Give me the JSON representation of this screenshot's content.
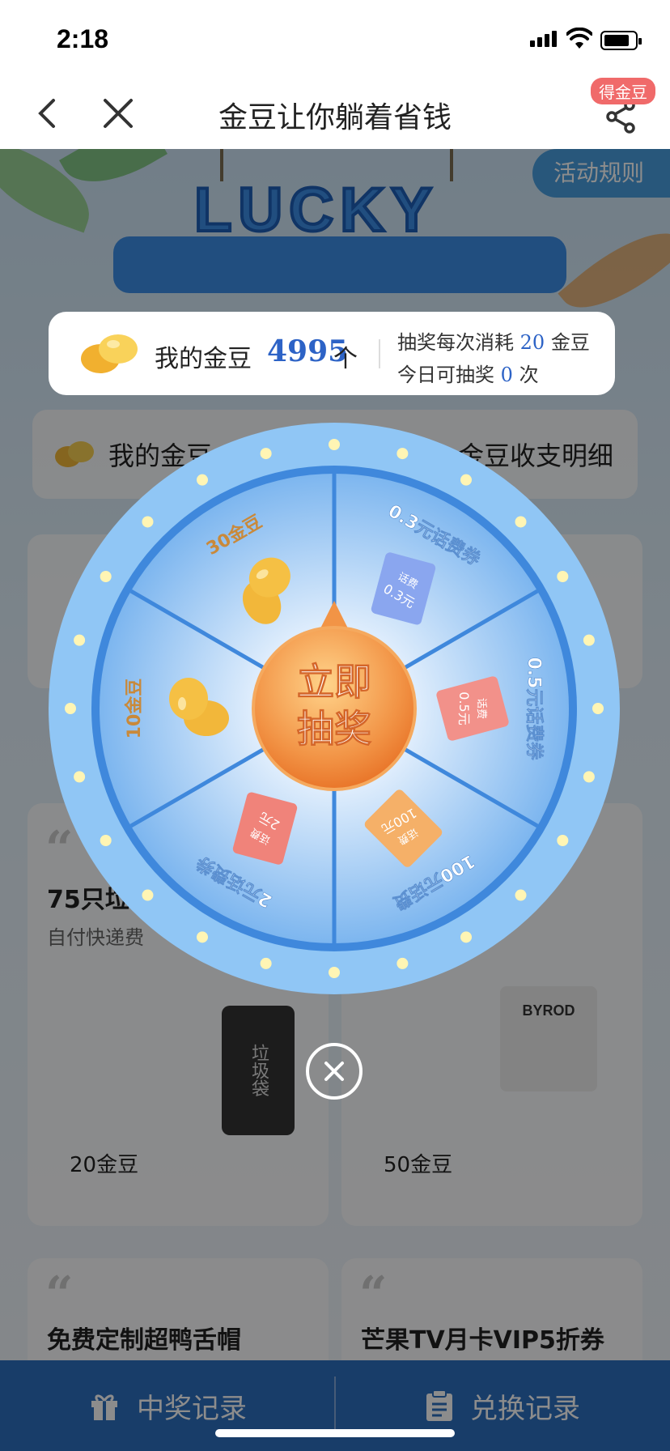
{
  "status_bar": {
    "time": "2:18"
  },
  "nav": {
    "title": "金豆让你躺着省钱",
    "badge": "得金豆"
  },
  "header": {
    "rules": "活动规则",
    "lucky": "LUCKY"
  },
  "points": {
    "label": "我的金豆",
    "value": "4995",
    "unit": "个",
    "line1_prefix": "抽奖每次消耗",
    "cost": "20",
    "line1_suffix": "金豆",
    "line2_prefix": "今日可抽奖",
    "remaining": "0",
    "line2_suffix": "次"
  },
  "background": {
    "row_left": "我的金豆",
    "row_right": "金豆收支明细",
    "goods": [
      {
        "title": "75只垃圾袋",
        "subtitle": "自付快递费",
        "image_text": "垃圾袋",
        "price": "20金豆"
      },
      {
        "title": "",
        "subtitle": "",
        "image_text": "BYROD",
        "price": "50金豆"
      }
    ],
    "goods_bottom": [
      {
        "title": "免费定制超鸭舌帽"
      },
      {
        "title": "芒果TV月卡VIP5折券"
      }
    ]
  },
  "wheel": {
    "center_button": [
      "立即",
      "抽奖"
    ],
    "prizes": [
      {
        "label": "0.3元话费券",
        "ticket": "话费",
        "ticket_value": "0.3元",
        "color": "#8aa6ef"
      },
      {
        "label": "0.5元话费券",
        "ticket": "话费",
        "ticket_value": "0.5元",
        "color": "#f2918a"
      },
      {
        "label": "100元话费",
        "ticket": "话费",
        "ticket_value": "100元",
        "color": "#f5b068"
      },
      {
        "label": "2元话费券",
        "ticket": "话费",
        "ticket_value": "2元",
        "color": "#f0837a"
      },
      {
        "label": "10金豆",
        "ticket": "",
        "ticket_value": "",
        "color": "#f5c044"
      },
      {
        "label": "30金豆",
        "ticket": "",
        "ticket_value": "",
        "color": "#f5c044"
      }
    ]
  },
  "bottom_bar": {
    "prize_record": "中奖记录",
    "exchange_record": "兑换记录"
  },
  "colors": {
    "accent": "#2d63c6",
    "wheel_blue": "#4d96e6",
    "button_orange": "#f08a3c"
  }
}
